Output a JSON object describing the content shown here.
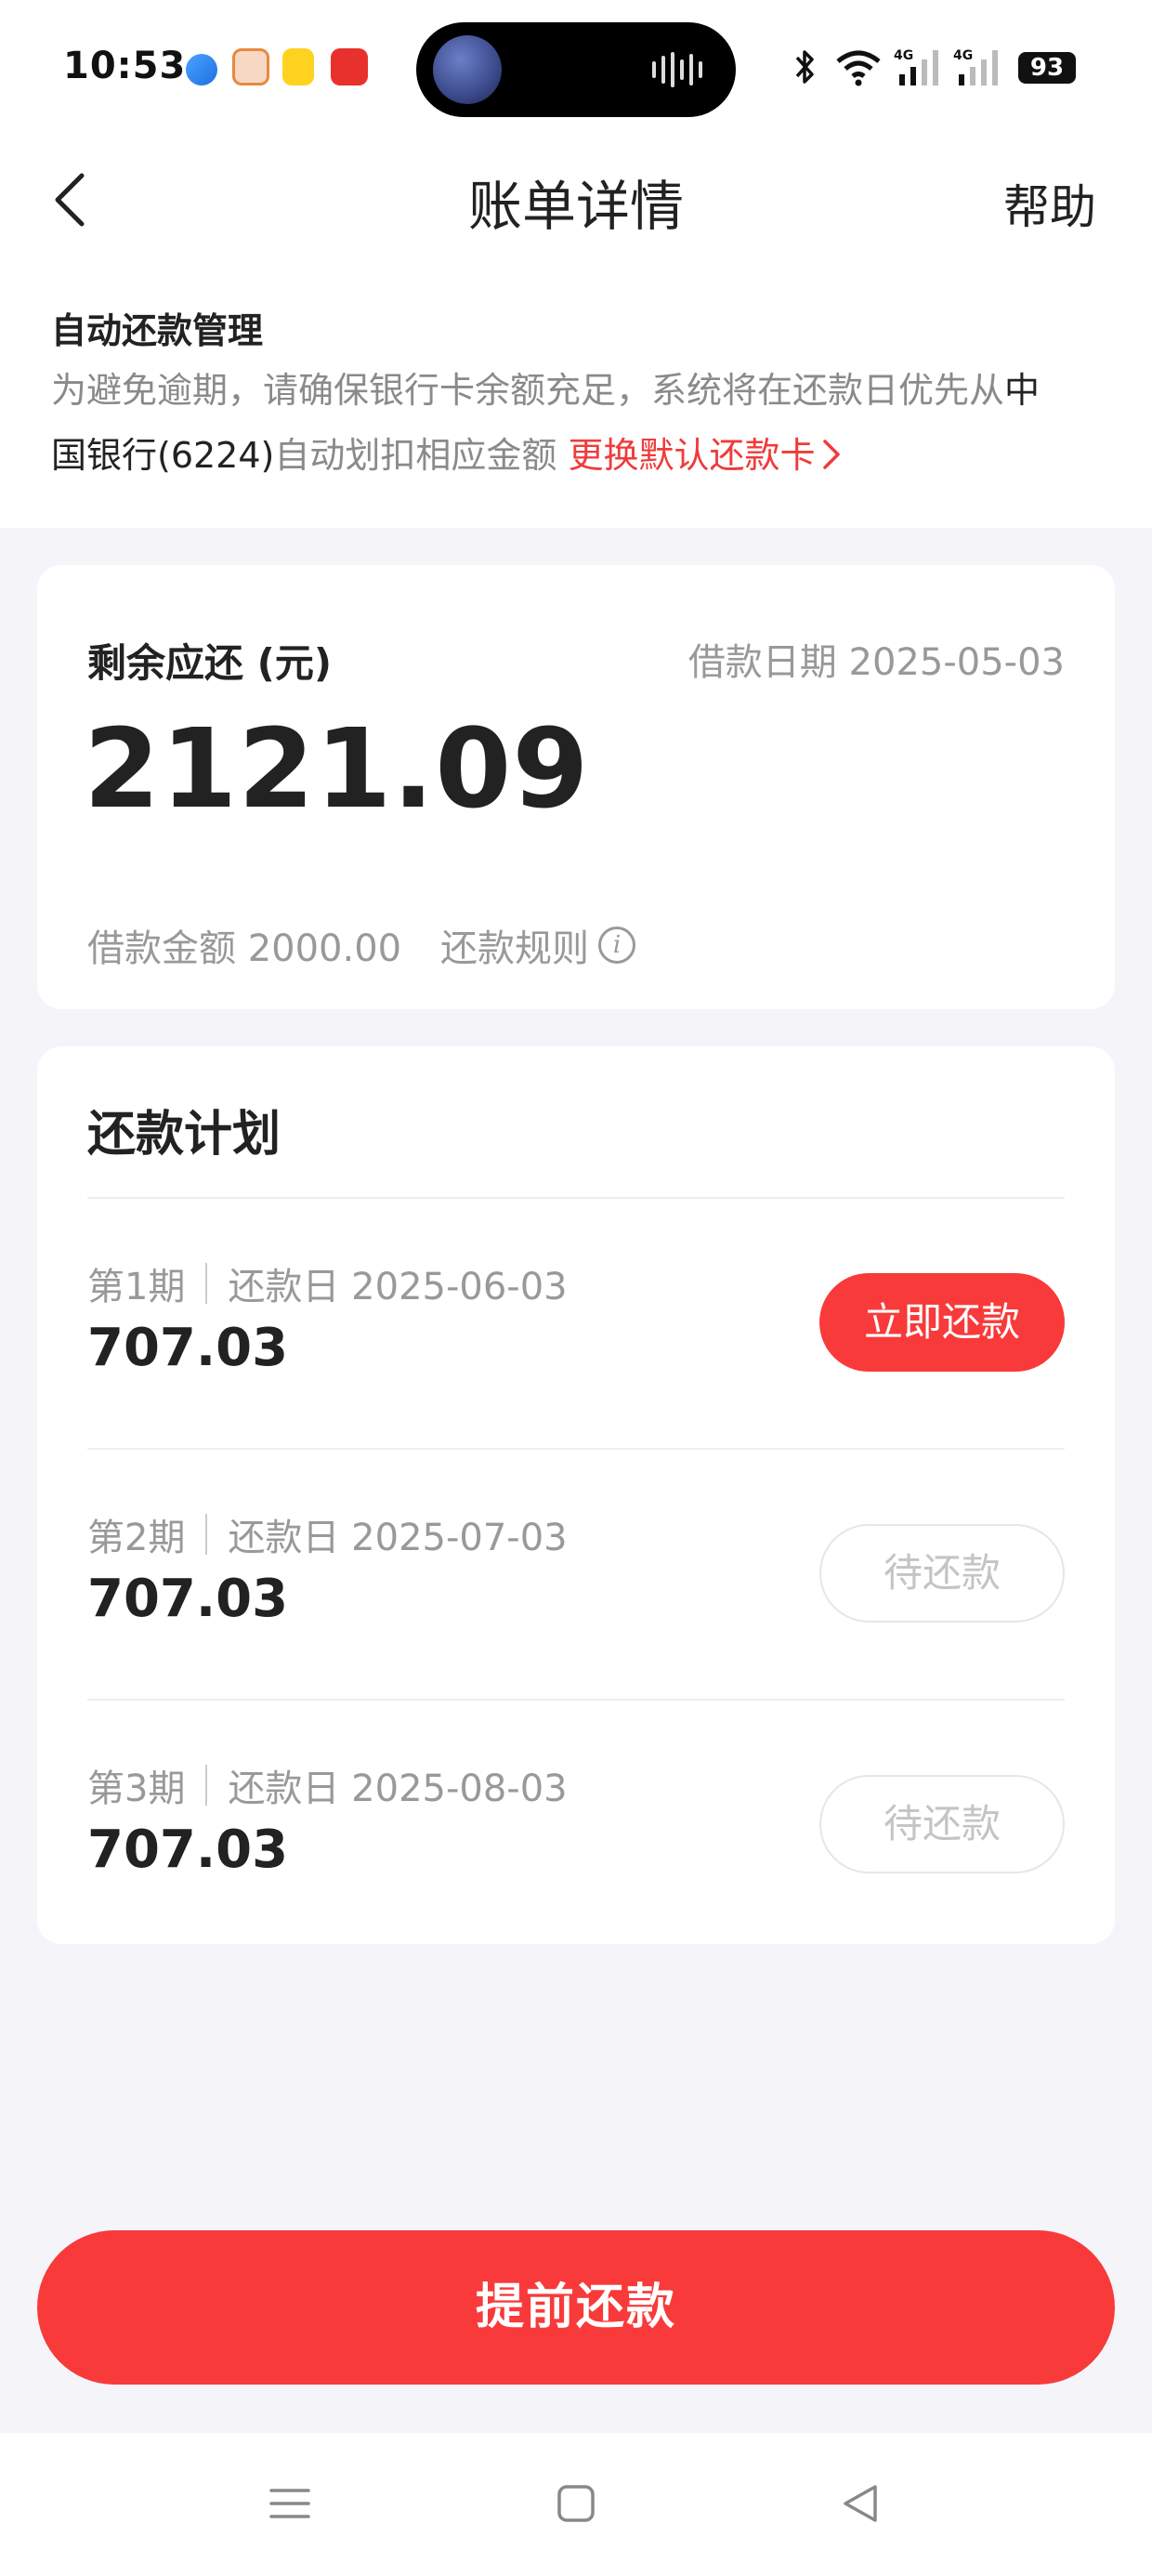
{
  "status_bar": {
    "time": "10:53",
    "battery": "93",
    "network": [
      "4G",
      "4G"
    ],
    "notification_icons": [
      "blue-app-icon",
      "dog-app-icon",
      "yellow-app-icon",
      "haofenqi-app-icon"
    ]
  },
  "navbar": {
    "title": "账单详情",
    "help": "帮助"
  },
  "auto_repay": {
    "title": "自动还款管理",
    "desc_1": "为避免逾期，请确保银行卡余额充足，系统将在还款日优先从",
    "bank_1": "中",
    "bank_2": "国银行(6224)",
    "desc_2": "自动划扣相应金额 ",
    "change_card": "更换默认还款卡"
  },
  "summary": {
    "remaining_label": "剩余应还 (元)",
    "loan_date": "借款日期 2025-05-03",
    "remaining_amount": "2121.09",
    "loan_amount": "借款金额 2000.00",
    "rule": "还款规则"
  },
  "plan": {
    "title": "还款计划",
    "periods": [
      {
        "period": "第1期",
        "due": "还款日 2025-06-03",
        "amount": "707.03",
        "action": "立即还款"
      },
      {
        "period": "第2期",
        "due": "还款日 2025-07-03",
        "amount": "707.03",
        "action": "待还款"
      },
      {
        "period": "第3期",
        "due": "还款日 2025-08-03",
        "amount": "707.03",
        "action": "待还款"
      }
    ]
  },
  "prepay_button": "提前还款",
  "colors": {
    "accent": "#f83a3a",
    "page_bg": "#f4f4f9",
    "muted_text": "#999999"
  }
}
